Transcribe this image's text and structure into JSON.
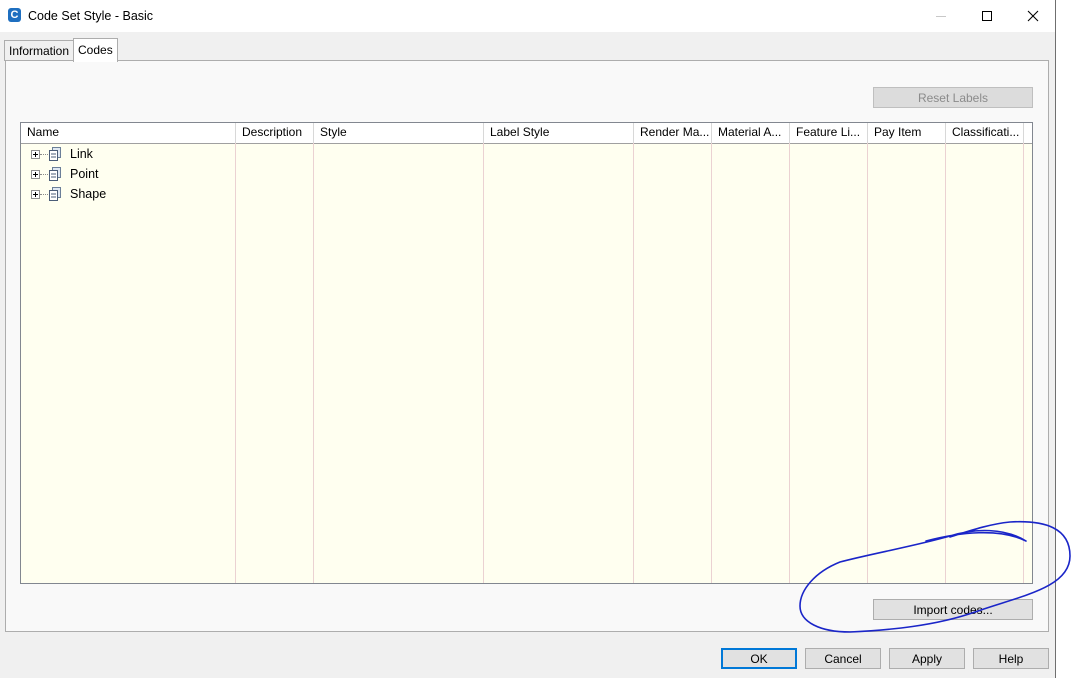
{
  "window": {
    "title": "Code Set Style - Basic",
    "app_icon_letter": "C"
  },
  "tabs": [
    {
      "label": "Information",
      "active": false
    },
    {
      "label": "Codes",
      "active": true
    }
  ],
  "buttons": {
    "reset_labels": "Reset Labels",
    "import_codes": "Import codes...",
    "ok": "OK",
    "cancel": "Cancel",
    "apply": "Apply",
    "help": "Help"
  },
  "grid": {
    "columns": [
      "Name",
      "Description",
      "Style",
      "Label Style",
      "Render Ma...",
      "Material A...",
      "Feature Li...",
      "Pay Item",
      "Classificati..."
    ],
    "rows": [
      {
        "label": "Link"
      },
      {
        "label": "Point"
      },
      {
        "label": "Shape"
      }
    ]
  },
  "colors": {
    "grid_background": "#fffff0",
    "annotation_stroke": "#1a25c8",
    "default_button_border": "#0078d7"
  },
  "icons": {
    "app": "civil3d-app-icon",
    "minimize": "minimize-icon",
    "maximize": "maximize-icon",
    "close": "close-icon",
    "expander": "plus-expander-icon",
    "node": "document-stack-icon"
  }
}
